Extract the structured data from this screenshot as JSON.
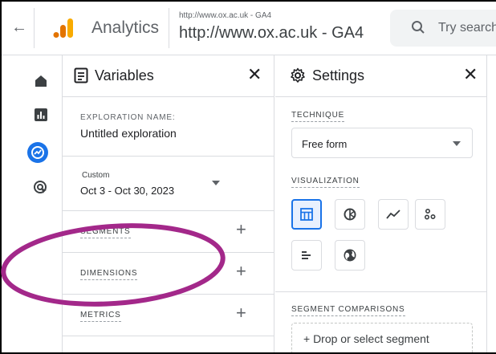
{
  "topbar": {
    "back_icon": "arrow-back-icon",
    "app_title": "Analytics",
    "property_small": "http://www.ox.ac.uk - GA4",
    "property_name": "http://www.ox.ac.uk - GA4",
    "search_placeholder": "Try search"
  },
  "rail": {
    "items": [
      "home-icon",
      "reports-icon",
      "explore-icon",
      "advertising-icon"
    ],
    "active": "explore-icon"
  },
  "variables": {
    "title": "Variables",
    "exploration_name_label": "EXPLORATION NAME:",
    "exploration_name_value": "Untitled exploration",
    "date_mode": "Custom",
    "date_range": "Oct 3 - Oct 30, 2023",
    "segments_label": "SEGMENTS",
    "dimensions_label": "DIMENSIONS",
    "metrics_label": "METRICS",
    "add_symbol": "+"
  },
  "settings": {
    "title": "Settings",
    "technique_label": "TECHNIQUE",
    "technique_value": "Free form",
    "visualization_label": "VISUALIZATION",
    "visualizations": [
      "table-icon",
      "donut-chart-icon",
      "line-chart-icon",
      "scatter-plot-icon",
      "bar-chart-icon",
      "geo-map-icon"
    ],
    "selected_visualization": "table-icon",
    "segment_comparisons_label": "SEGMENT COMPARISONS",
    "drop_segment_text": "+ Drop or select segment"
  },
  "colors": {
    "accent": "#1a73e8",
    "annotation": "#a3288a",
    "logo_orange": "#f9ab00",
    "logo_dark": "#e37400"
  }
}
